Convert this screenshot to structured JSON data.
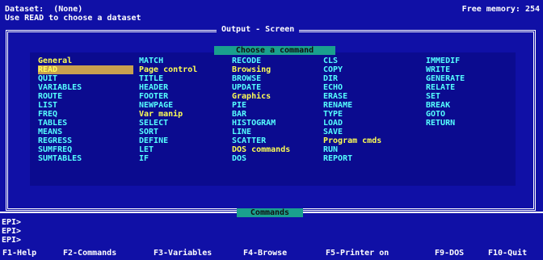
{
  "status": {
    "dataset_line": "Dataset:  (None)",
    "hint_line": "Use READ to choose a dataset",
    "free_memory": "Free memory: 254"
  },
  "output_window": {
    "title": "Output - Screen"
  },
  "menu": {
    "title": "Choose a command",
    "columns": [
      {
        "items": [
          {
            "text": "General",
            "kind": "head"
          },
          {
            "text": "READ",
            "kind": "selected"
          },
          {
            "text": "QUIT",
            "kind": "cmd"
          },
          {
            "text": "VARIABLES",
            "kind": "cmd"
          },
          {
            "text": "ROUTE",
            "kind": "cmd"
          },
          {
            "text": "LIST",
            "kind": "cmd"
          },
          {
            "text": "FREQ",
            "kind": "cmd"
          },
          {
            "text": "TABLES",
            "kind": "cmd"
          },
          {
            "text": "MEANS",
            "kind": "cmd"
          },
          {
            "text": "REGRESS",
            "kind": "cmd"
          },
          {
            "text": "SUMFREQ",
            "kind": "cmd"
          },
          {
            "text": "SUMTABLES",
            "kind": "cmd"
          }
        ]
      },
      {
        "items": [
          {
            "text": "MATCH",
            "kind": "cmd"
          },
          {
            "text": "Page control",
            "kind": "head"
          },
          {
            "text": "TITLE",
            "kind": "cmd"
          },
          {
            "text": "HEADER",
            "kind": "cmd"
          },
          {
            "text": "FOOTER",
            "kind": "cmd"
          },
          {
            "text": "NEWPAGE",
            "kind": "cmd"
          },
          {
            "text": "Var manip",
            "kind": "head"
          },
          {
            "text": "SELECT",
            "kind": "cmd"
          },
          {
            "text": "SORT",
            "kind": "cmd"
          },
          {
            "text": "DEFINE",
            "kind": "cmd"
          },
          {
            "text": "LET",
            "kind": "cmd"
          },
          {
            "text": "IF",
            "kind": "cmd"
          }
        ]
      },
      {
        "items": [
          {
            "text": "RECODE",
            "kind": "cmd"
          },
          {
            "text": "Browsing",
            "kind": "head"
          },
          {
            "text": "BROWSE",
            "kind": "cmd"
          },
          {
            "text": "UPDATE",
            "kind": "cmd"
          },
          {
            "text": "Graphics",
            "kind": "head"
          },
          {
            "text": "PIE",
            "kind": "cmd"
          },
          {
            "text": "BAR",
            "kind": "cmd"
          },
          {
            "text": "HISTOGRAM",
            "kind": "cmd"
          },
          {
            "text": "LINE",
            "kind": "cmd"
          },
          {
            "text": "SCATTER",
            "kind": "cmd"
          },
          {
            "text": "DOS commands",
            "kind": "head"
          },
          {
            "text": "DOS",
            "kind": "cmd"
          }
        ]
      },
      {
        "items": [
          {
            "text": "CLS",
            "kind": "cmd"
          },
          {
            "text": "COPY",
            "kind": "cmd"
          },
          {
            "text": "DIR",
            "kind": "cmd"
          },
          {
            "text": "ECHO",
            "kind": "cmd"
          },
          {
            "text": "ERASE",
            "kind": "cmd"
          },
          {
            "text": "RENAME",
            "kind": "cmd"
          },
          {
            "text": "TYPE",
            "kind": "cmd"
          },
          {
            "text": "LOAD",
            "kind": "cmd"
          },
          {
            "text": "SAVE",
            "kind": "cmd"
          },
          {
            "text": "Program cmds",
            "kind": "head"
          },
          {
            "text": "RUN",
            "kind": "cmd"
          },
          {
            "text": "REPORT",
            "kind": "cmd"
          }
        ]
      },
      {
        "items": [
          {
            "text": "IMMEDIF",
            "kind": "cmd"
          },
          {
            "text": "WRITE",
            "kind": "cmd"
          },
          {
            "text": "GENERATE",
            "kind": "cmd"
          },
          {
            "text": "RELATE",
            "kind": "cmd"
          },
          {
            "text": "SET",
            "kind": "cmd"
          },
          {
            "text": "BREAK",
            "kind": "cmd"
          },
          {
            "text": "GOTO",
            "kind": "cmd"
          },
          {
            "text": "RETURN",
            "kind": "cmd"
          }
        ]
      }
    ]
  },
  "commands_panel": {
    "title": "Commands",
    "prompts": [
      "EPI>",
      "EPI>",
      "EPI>"
    ]
  },
  "function_keys": [
    "F1-Help",
    "F2-Commands",
    "F3-Variables",
    "F4-Browse",
    "F5-Printer on",
    "F9-DOS",
    "F10-Quit"
  ]
}
